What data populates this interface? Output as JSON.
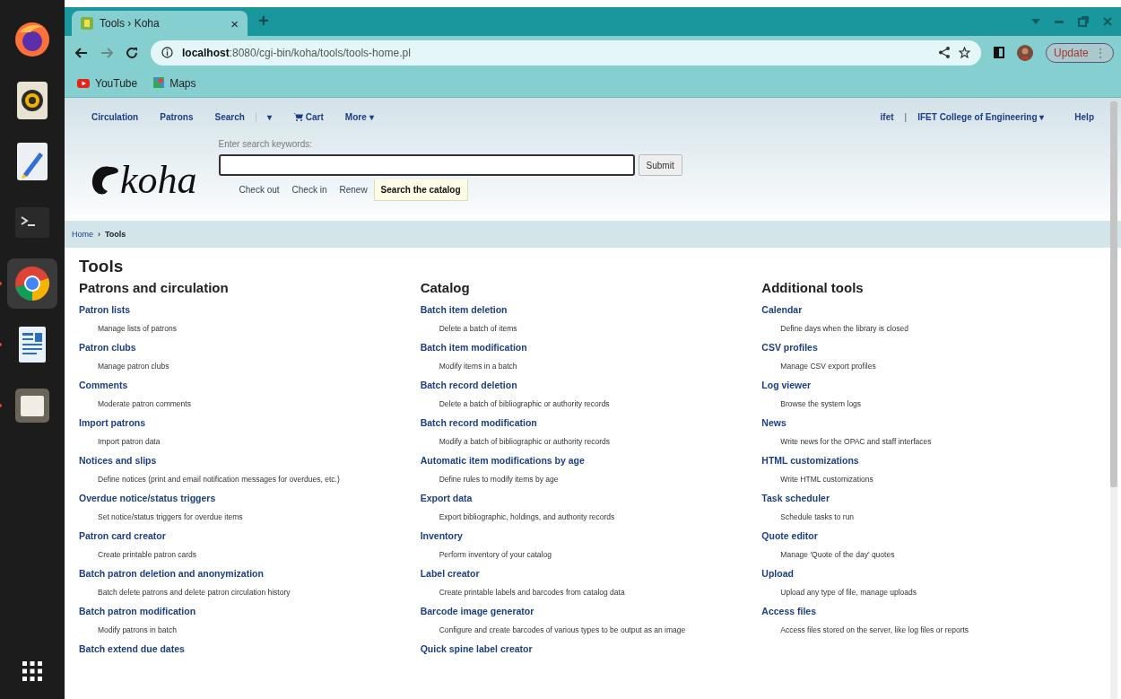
{
  "dock": {
    "items": [
      {
        "kind": "firefox",
        "running": false,
        "selected": false
      },
      {
        "kind": "speaker",
        "running": false,
        "selected": false
      },
      {
        "kind": "editor",
        "running": false,
        "selected": false
      },
      {
        "kind": "terminal",
        "running": false,
        "selected": false
      },
      {
        "kind": "chrome",
        "running": true,
        "selected": true
      },
      {
        "kind": "writer",
        "running": true,
        "selected": false
      },
      {
        "kind": "files",
        "running": true,
        "selected": false
      }
    ]
  },
  "browser": {
    "tab": {
      "title": "Tools › Koha",
      "close": "×"
    },
    "new_tab": "+",
    "url": "**localhost**:8080/cgi-bin/koha/tools/tools-home.pl",
    "update": "Update",
    "menu": "⋮",
    "bookmarks": [
      {
        "kind": "youtube",
        "label": "YouTube"
      },
      {
        "kind": "maps",
        "label": "Maps"
      }
    ]
  },
  "koha": {
    "nav": [
      {
        "kind": "link",
        "label": "Circulation"
      },
      {
        "kind": "link",
        "label": "Patrons"
      },
      {
        "kind": "link",
        "label": "Search"
      },
      {
        "kind": "caret",
        "label": "▾"
      },
      {
        "kind": "cart",
        "label": "Cart"
      },
      {
        "kind": "link",
        "label": "More ▾"
      }
    ],
    "user": "ifet",
    "separator": "|",
    "library": "IFET College of Engineering ▾",
    "help": "Help",
    "search_label": "Enter search keywords:",
    "submit": "Submit",
    "search_tabs": [
      {
        "label": "Check out",
        "selected": false
      },
      {
        "label": "Check in",
        "selected": false
      },
      {
        "label": "Renew",
        "selected": false
      },
      {
        "label": "Search the catalog",
        "selected": true
      }
    ],
    "breadcrumb": {
      "home": "Home",
      "sep": "›",
      "current": "Tools"
    },
    "title": "Tools",
    "logo": "koha",
    "columns": [
      {
        "heading": "Patrons and circulation",
        "items": [
          {
            "label": "Patron lists",
            "description": "Manage lists of patrons"
          },
          {
            "label": "Patron clubs",
            "description": "Manage patron clubs"
          },
          {
            "label": "Comments",
            "description": "Moderate patron comments"
          },
          {
            "label": "Import patrons",
            "description": "Import patron data"
          },
          {
            "label": "Notices and slips",
            "description": "Define notices (print and email notification messages for overdues, etc.)"
          },
          {
            "label": "Overdue notice/status triggers",
            "description": "Set notice/status triggers for overdue items"
          },
          {
            "label": "Patron card creator",
            "description": "Create printable patron cards"
          },
          {
            "label": "Batch patron deletion and anonymization",
            "description": "Batch delete patrons and delete patron circulation history"
          },
          {
            "label": "Batch patron modification",
            "description": "Modify patrons in batch"
          },
          {
            "label": "Batch extend due dates"
          }
        ]
      },
      {
        "heading": "Catalog",
        "items": [
          {
            "label": "Batch item deletion",
            "description": "Delete a batch of items"
          },
          {
            "label": "Batch item modification",
            "description": "Modify items in a batch"
          },
          {
            "label": "Batch record deletion",
            "description": "Delete a batch of bibliographic or authority records"
          },
          {
            "label": "Batch record modification",
            "description": "Modify a batch of bibliographic or authority records"
          },
          {
            "label": "Automatic item modifications by age",
            "description": "Define rules to modify items by age"
          },
          {
            "label": "Export data",
            "description": "Export bibliographic, holdings, and authority records"
          },
          {
            "label": "Inventory",
            "description": "Perform inventory of your catalog"
          },
          {
            "label": "Label creator",
            "description": "Create printable labels and barcodes from catalog data"
          },
          {
            "label": "Barcode image generator",
            "description": "Configure and create barcodes of various types to be output as an image"
          },
          {
            "label": "Quick spine label creator"
          }
        ]
      },
      {
        "heading": "Additional tools",
        "items": [
          {
            "label": "Calendar",
            "description": "Define days when the library is closed"
          },
          {
            "label": "CSV profiles",
            "description": "Manage CSV export profiles"
          },
          {
            "label": "Log viewer",
            "description": "Browse the system logs"
          },
          {
            "label": "News",
            "description": "Write news for the OPAC and staff interfaces"
          },
          {
            "label": "HTML customizations",
            "description": "Write HTML customizations"
          },
          {
            "label": "Task scheduler",
            "description": "Schedule tasks to run"
          },
          {
            "label": "Quote editor",
            "description": "Manage 'Quote of the day' quotes"
          },
          {
            "label": "Upload",
            "description": "Upload any type of file, manage uploads"
          },
          {
            "label": "Access files",
            "description": "Access files stored on the server, like log files or reports"
          }
        ]
      }
    ]
  }
}
